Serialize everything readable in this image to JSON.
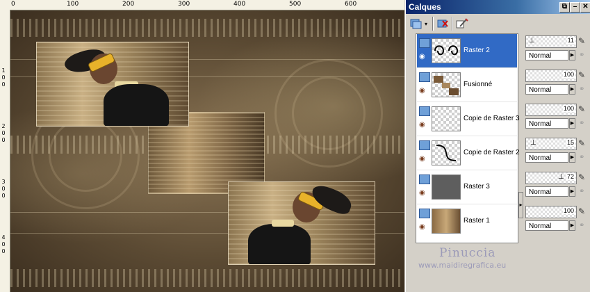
{
  "rulers": {
    "top_labels": [
      "0",
      "100",
      "200",
      "300",
      "400",
      "500",
      "600"
    ],
    "left_labels": [
      "1",
      "0",
      "0",
      "2",
      "0",
      "0",
      "3",
      "0",
      "0",
      "4",
      "0",
      "0"
    ]
  },
  "palette": {
    "title": "Calques",
    "title_buttons": [
      "⧉",
      "–",
      "✕"
    ]
  },
  "layers": [
    {
      "name": "Raster 2",
      "selected": true,
      "opacity": "11",
      "blend": "Normal"
    },
    {
      "name": "Fusionné",
      "selected": false,
      "opacity": "100",
      "blend": "Normal"
    },
    {
      "name": "Copie de Raster 3",
      "selected": false,
      "opacity": "100",
      "blend": "Normal"
    },
    {
      "name": "Copie de Raster 2",
      "selected": false,
      "opacity": "15",
      "blend": "Normal"
    },
    {
      "name": "Raster 3",
      "selected": false,
      "opacity": "72",
      "blend": "Normal"
    },
    {
      "name": "Raster 1",
      "selected": false,
      "opacity": "100",
      "blend": "Normal"
    }
  ],
  "watermark": {
    "name": "Pinuccia",
    "url": "www.maidiregrafica.eu"
  },
  "colors": {
    "title_bar": "#0a246a",
    "selection": "#316ac5",
    "canvas_tone": "#5b4a33"
  }
}
